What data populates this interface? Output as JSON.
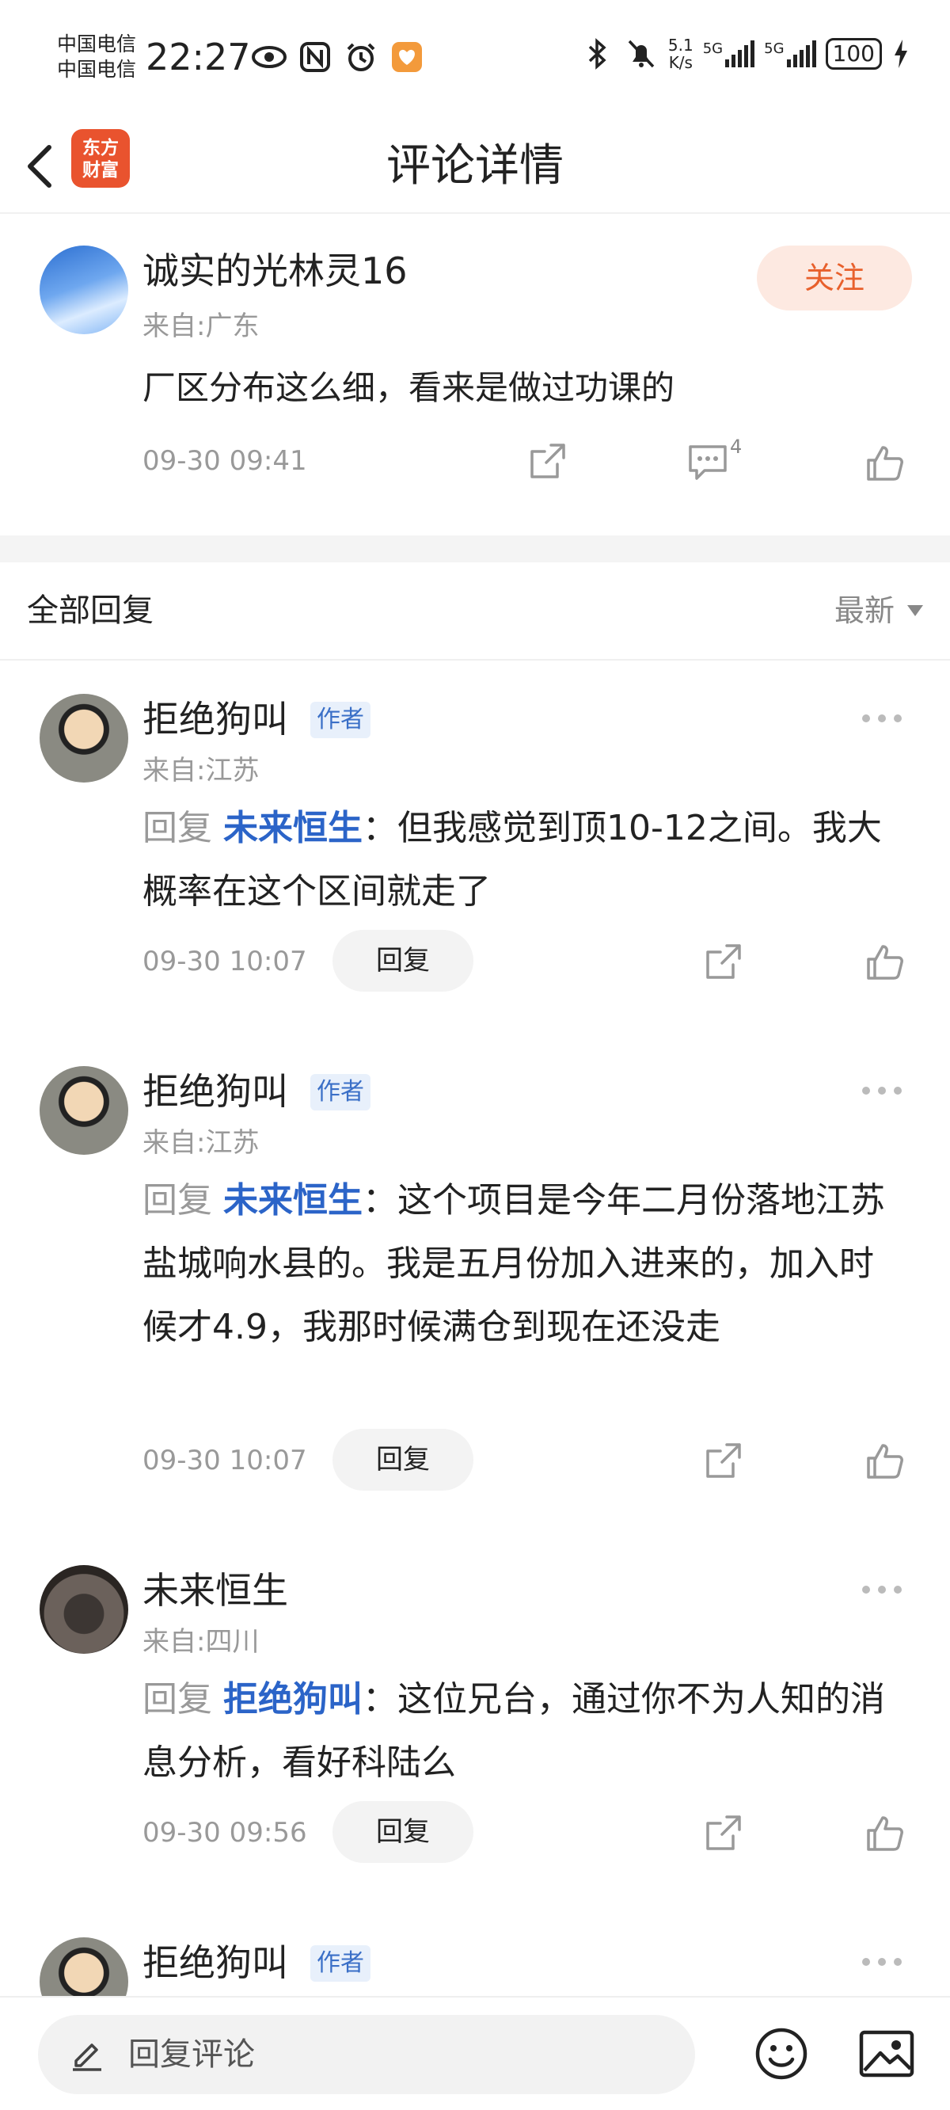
{
  "status_bar": {
    "carrier1": "中国电信",
    "carrier2": "中国电信",
    "time": "22:27",
    "net_speed_value": "5.1",
    "net_speed_unit": "K/s",
    "signal1": "5G",
    "signal2": "5G",
    "battery": "100",
    "icons_left": [
      "eye-icon",
      "nfc-icon",
      "alarm-icon",
      "app-notification-icon"
    ],
    "icons_right": [
      "bluetooth-icon",
      "mute-icon",
      "charging-icon"
    ]
  },
  "header": {
    "title": "评论详情",
    "logo_line1": "东方",
    "logo_line2": "财富"
  },
  "main_comment": {
    "user": "诚实的光林灵16",
    "location": "来自:广东",
    "follow_label": "关注",
    "text": "厂区分布这么细，看来是做过功课的",
    "time": "09-30 09:41",
    "reply_count": "4"
  },
  "replies_section": {
    "title": "全部回复",
    "sort_label": "最新"
  },
  "replies": [
    {
      "user": "拒绝狗叫",
      "tag": "作者",
      "location": "来自:江苏",
      "reply_word": "回复",
      "mention": "未来恒生",
      "text": "：但我感觉到顶10-12之间。我大概率在这个区间就走了",
      "time": "09-30 10:07",
      "reply_label": "回复"
    },
    {
      "user": "拒绝狗叫",
      "tag": "作者",
      "location": "来自:江苏",
      "reply_word": "回复",
      "mention": "未来恒生",
      "text": "：这个项目是今年二月份落地江苏盐城响水县的。我是五月份加入进来的，加入时候才4.9，我那时候满仓到现在还没走",
      "time": "09-30 10:07",
      "reply_label": "回复"
    },
    {
      "user": "未来恒生",
      "tag": "",
      "location": "来自:四川",
      "reply_word": "回复",
      "mention": "拒绝狗叫",
      "text": "：这位兄台，通过你不为人知的消息分析，看好科陆么",
      "time": "09-30 09:56",
      "reply_label": "回复"
    },
    {
      "user": "拒绝狗叫",
      "tag": "作者"
    }
  ],
  "bottom_bar": {
    "placeholder": "回复评论"
  },
  "colors": {
    "accent_orange": "#e8602c",
    "mention_blue": "#2b64c8",
    "logo_red": "#e9532e"
  }
}
